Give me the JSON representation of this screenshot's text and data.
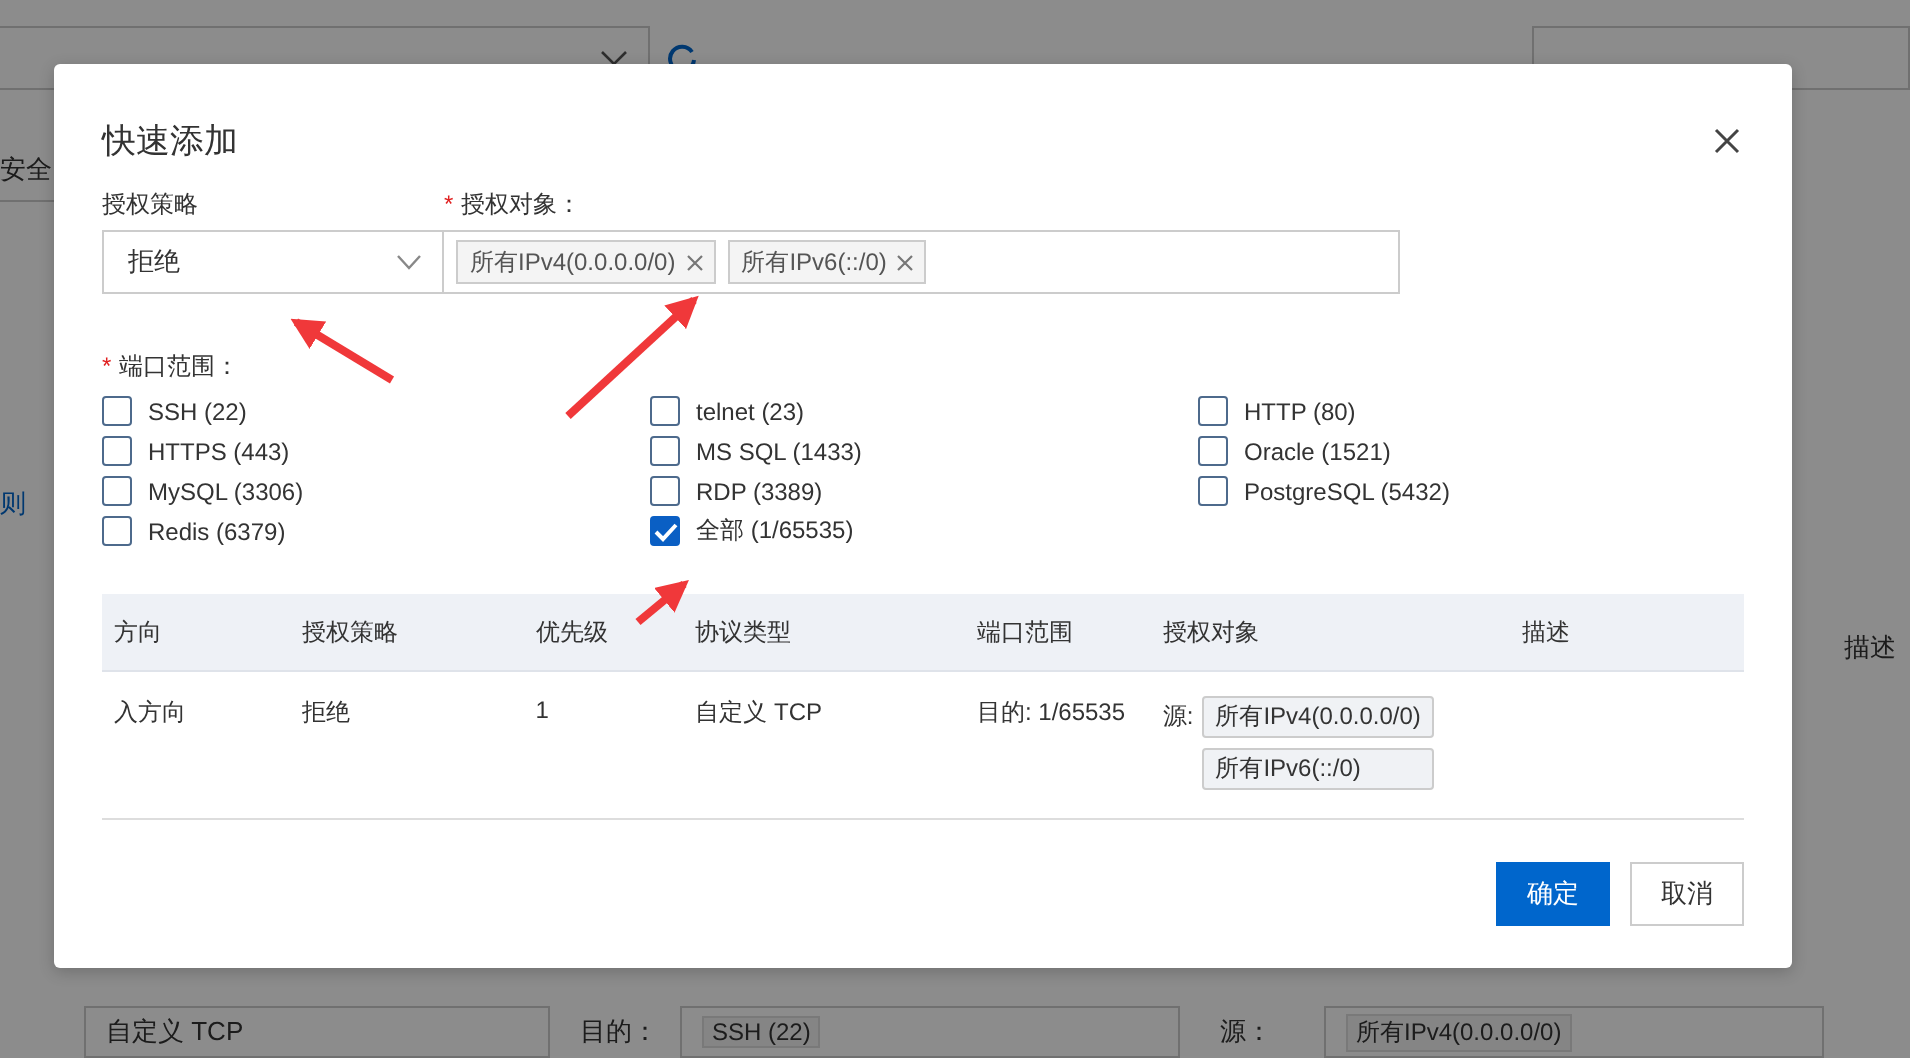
{
  "background": {
    "tab": "安全",
    "side_link": "则",
    "column_header": "描述",
    "rule_row": {
      "protocol": "自定义 TCP",
      "destination_label": "目的：",
      "destination_tag": "SSH (22)",
      "source_label": "源：",
      "source_tag": "所有IPv4(0.0.0.0/0)"
    }
  },
  "dialog": {
    "title": "快速添加",
    "policy": {
      "label": "授权策略",
      "value": "拒绝"
    },
    "objects": {
      "required_mark": "*",
      "label": "授权对象：",
      "tags": [
        "所有IPv4(0.0.0.0/0)",
        "所有IPv6(::/0)"
      ]
    },
    "ports": {
      "required_mark": "*",
      "label": "端口范围：",
      "options": [
        {
          "label": "SSH (22)",
          "checked": false
        },
        {
          "label": "telnet (23)",
          "checked": false
        },
        {
          "label": "HTTP (80)",
          "checked": false
        },
        {
          "label": "HTTPS (443)",
          "checked": false
        },
        {
          "label": "MS SQL (1433)",
          "checked": false
        },
        {
          "label": "Oracle (1521)",
          "checked": false
        },
        {
          "label": "MySQL (3306)",
          "checked": false
        },
        {
          "label": "RDP (3389)",
          "checked": false
        },
        {
          "label": "PostgreSQL (5432)",
          "checked": false
        },
        {
          "label": "Redis (6379)",
          "checked": false
        },
        {
          "label": "全部 (1/65535)",
          "checked": true
        }
      ]
    },
    "table": {
      "columns": [
        "方向",
        "授权策略",
        "优先级",
        "协议类型",
        "端口范围",
        "授权对象",
        "描述"
      ],
      "rows": [
        {
          "direction": "入方向",
          "policy": "拒绝",
          "priority": "1",
          "protocol": "自定义 TCP",
          "port_range": "目的: 1/65535",
          "source_label": "源:",
          "objects": [
            "所有IPv4(0.0.0.0/0)",
            "所有IPv6(::/0)"
          ]
        }
      ]
    },
    "buttons": [
      {
        "label": "确定",
        "kind": "primary"
      },
      {
        "label": "取消",
        "kind": "secondary"
      }
    ]
  }
}
